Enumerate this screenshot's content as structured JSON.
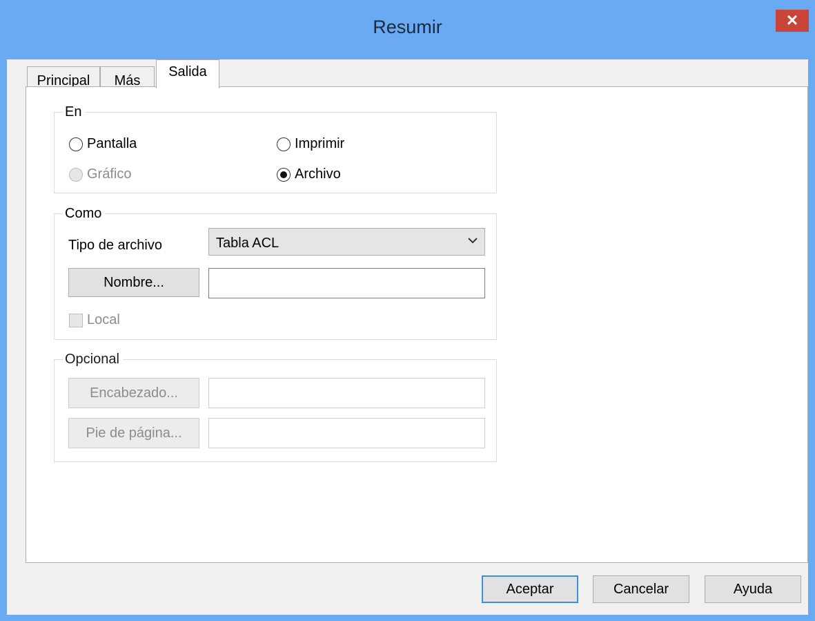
{
  "window": {
    "title": "Resumir",
    "close_label": "✕"
  },
  "tabs": [
    {
      "label": "Principal",
      "active": false
    },
    {
      "label": "Más",
      "active": false
    },
    {
      "label": "Salida",
      "active": true
    }
  ],
  "groups": {
    "en": {
      "title": "En",
      "options": {
        "pantalla": {
          "label": "Pantalla",
          "checked": false,
          "enabled": true
        },
        "imprimir": {
          "label": "Imprimir",
          "checked": false,
          "enabled": true
        },
        "grafico": {
          "label": "Gráfico",
          "checked": false,
          "enabled": false
        },
        "archivo": {
          "label": "Archivo",
          "checked": true,
          "enabled": true
        }
      }
    },
    "como": {
      "title": "Como",
      "file_type_label": "Tipo de archivo",
      "file_type_value": "Tabla ACL",
      "name_button": "Nombre...",
      "name_value": "",
      "local_label": "Local",
      "local_checked": false
    },
    "opcional": {
      "title": "Opcional",
      "header_button": "Encabezado...",
      "header_value": "",
      "footer_button": "Pie de página...",
      "footer_value": ""
    }
  },
  "buttons": {
    "ok": "Aceptar",
    "cancel": "Cancelar",
    "help": "Ayuda"
  },
  "colors": {
    "titlebar": "#6aa9f4",
    "close": "#c9453a",
    "default_border": "#3c8fdb"
  }
}
